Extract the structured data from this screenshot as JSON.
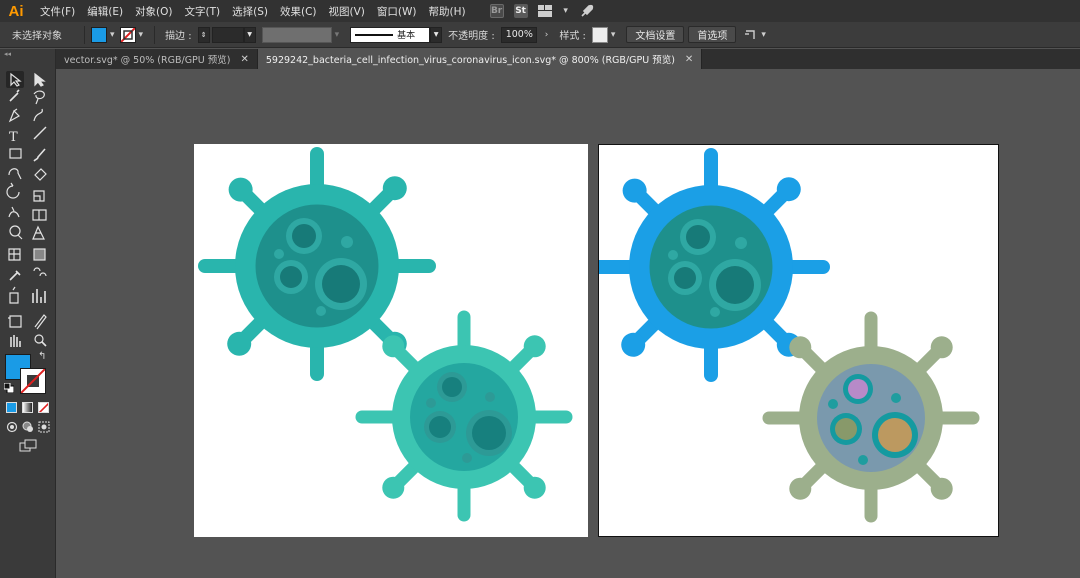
{
  "app": {
    "logo": "Ai"
  },
  "menu": [
    "文件(F)",
    "编辑(E)",
    "对象(O)",
    "文字(T)",
    "选择(S)",
    "效果(C)",
    "视图(V)",
    "窗口(W)",
    "帮助(H)"
  ],
  "menu_icons": {
    "bridge": "Br",
    "stock": "St"
  },
  "control": {
    "selection_status": "未选择对象",
    "fill_color": "#1a9be6",
    "stroke_label": "描边 :",
    "stroke_weight": "",
    "brush_label": "基本",
    "opacity_label": "不透明度 :",
    "opacity_value": "100%",
    "style_label": "样式 :",
    "doc_setup_button": "文档设置",
    "preferences_button": "首选项"
  },
  "tabs": [
    {
      "label": "vector.svg* @ 50% (RGB/GPU 预览)",
      "active": false
    },
    {
      "label": "5929242_bacteria_cell_infection_virus_coronavirus_icon.svg*  @  800%  (RGB/GPU 预览)",
      "active": true
    }
  ],
  "colors": {
    "v1_body": "#29b5ad",
    "v1_inner": "#1e908c",
    "v1_dark": "#177a78",
    "v1_spot": "#2fa8a3",
    "v2_body": "#3cc5b2",
    "v2_inner": "#24a7a0",
    "v2_dark": "#17807e",
    "v2_spot": "#2d9a96",
    "v3_body": "#1b9fe6",
    "v3_inner": "#1e908c",
    "v3_dark": "#177a78",
    "v3_spot": "#2fa8a3",
    "v4_body": "#9caf8c",
    "v4_inner": "#7a99ad",
    "v4_ring": "#159aa0",
    "v4_purple": "#b78ac8",
    "v4_olive": "#88996a",
    "v4_tan": "#bc9960",
    "v4_spot": "#1f9d9f"
  }
}
